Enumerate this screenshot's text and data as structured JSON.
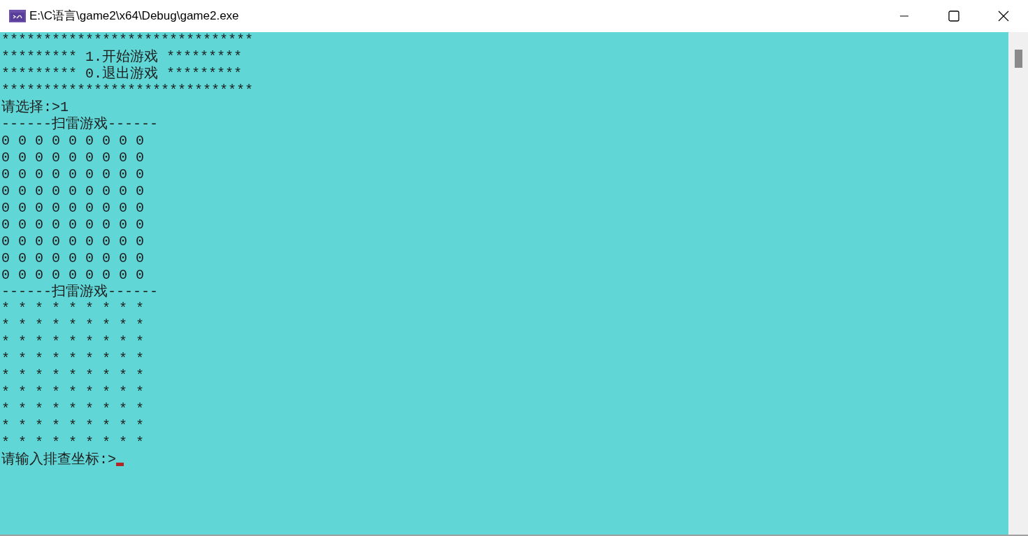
{
  "window": {
    "title": "E:\\C语言\\game2\\x64\\Debug\\game2.exe"
  },
  "console": {
    "lines": [
      "******************************",
      "********* 1.开始游戏 *********",
      "********* 0.退出游戏 *********",
      "******************************",
      "请选择:>1",
      "------扫雷游戏------",
      "0 0 0 0 0 0 0 0 0",
      "0 0 0 0 0 0 0 0 0",
      "0 0 0 0 0 0 0 0 0",
      "0 0 0 0 0 0 0 0 0",
      "0 0 0 0 0 0 0 0 0",
      "0 0 0 0 0 0 0 0 0",
      "0 0 0 0 0 0 0 0 0",
      "0 0 0 0 0 0 0 0 0",
      "0 0 0 0 0 0 0 0 0",
      "------扫雷游戏------",
      "* * * * * * * * *",
      "* * * * * * * * *",
      "* * * * * * * * *",
      "* * * * * * * * *",
      "* * * * * * * * *",
      "* * * * * * * * *",
      "* * * * * * * * *",
      "* * * * * * * * *",
      "* * * * * * * * *"
    ],
    "prompt": "请输入排查坐标:>"
  }
}
